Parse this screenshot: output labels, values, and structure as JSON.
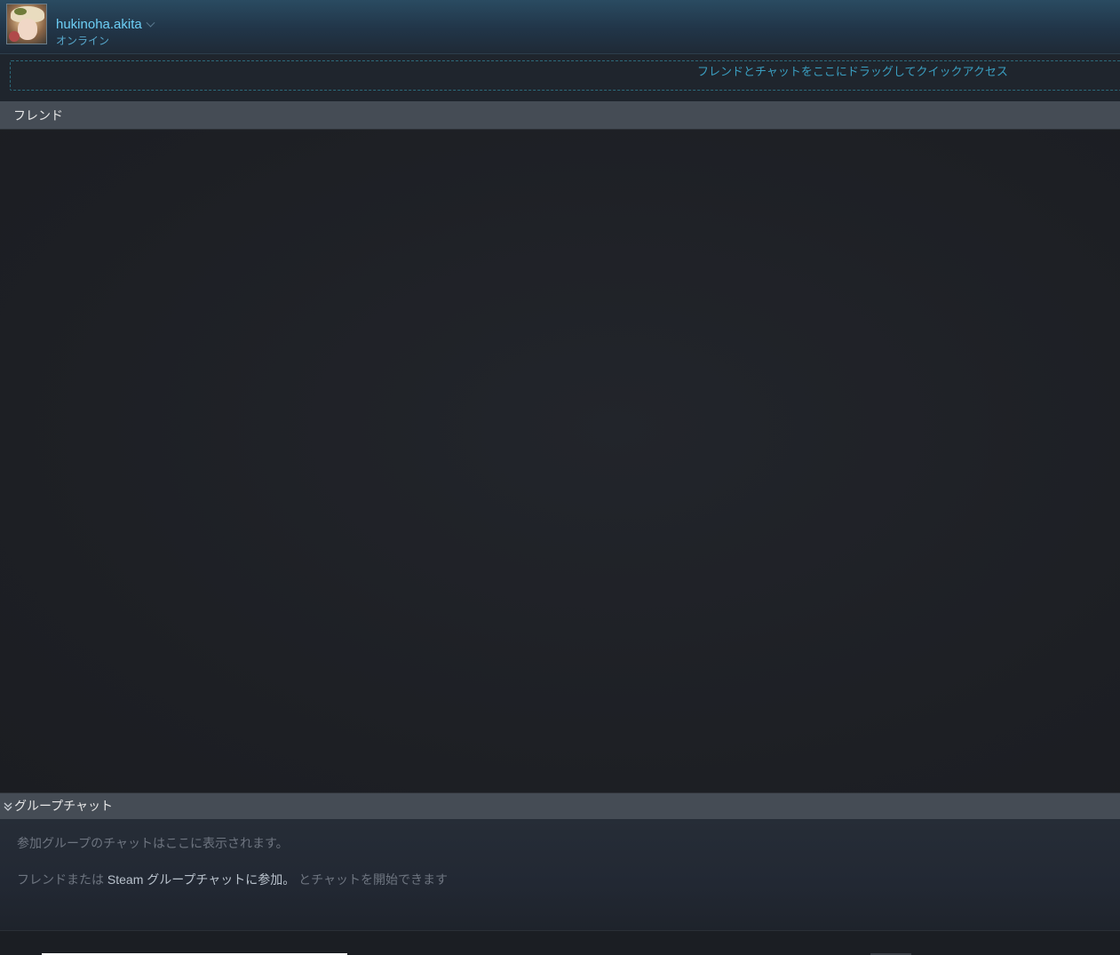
{
  "header": {
    "username": "hukinoha.akita",
    "status": "オンライン"
  },
  "quick_access": {
    "hint": "フレンドとチャットをここにドラッグしてクイックアクセス"
  },
  "friends_section": {
    "title": "フレンド"
  },
  "group_chat_section": {
    "title": "グループチャット",
    "empty_message": "参加グループのチャットはここに表示されます。",
    "join_prefix": "フレンドまたは",
    "join_link": "Steam グループチャットに参加。",
    "join_suffix": "とチャットを開始できます"
  },
  "colors": {
    "accent": "#6dcff6",
    "status_online": "#57a7cb",
    "section_header_bg": "#454c55",
    "body_bg": "#1e2025"
  }
}
